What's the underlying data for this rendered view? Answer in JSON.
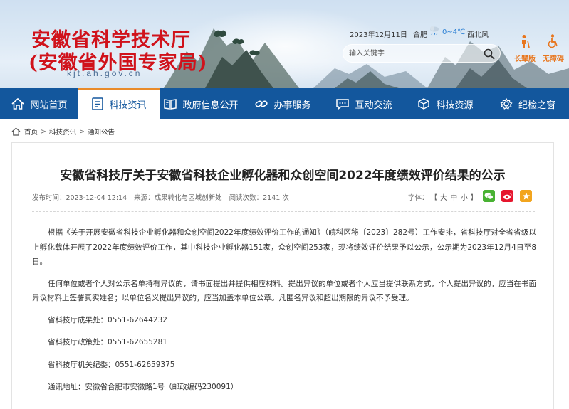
{
  "header": {
    "org_name_line1": "安徽省科学技术厅",
    "org_name_line2": "(安徽省外国专家局)",
    "url": "kjt.ah.gov.cn",
    "date": "2023年12月11日",
    "city": "合肥",
    "temperature": "0~4℃",
    "wind": "西北风",
    "search_placeholder": "输入关键字",
    "elder_mode_label": "长辈版",
    "accessibility_label": "无障碍"
  },
  "nav": {
    "items": [
      {
        "label": "网站首页",
        "icon": "home-icon"
      },
      {
        "label": "科技资讯",
        "icon": "document-icon",
        "active": true
      },
      {
        "label": "政府信息公开",
        "icon": "book-icon"
      },
      {
        "label": "办事服务",
        "icon": "link-icon"
      },
      {
        "label": "互动交流",
        "icon": "chat-icon"
      },
      {
        "label": "科技资源",
        "icon": "cube-icon"
      },
      {
        "label": "纪检之窗",
        "icon": "gear-icon"
      }
    ]
  },
  "breadcrumb": [
    "首页",
    "科技资讯",
    "通知公告"
  ],
  "article": {
    "title": "安徽省科技厅关于安徽省科技企业孵化器和众创空间2022年度绩效评价结果的公示",
    "publish_time": "发布时间：2023-12-04 12:14",
    "source": "来源：成果转化与区域创新处",
    "views": "阅读次数：2141 次",
    "font_label": "字体：",
    "font_large": "大",
    "font_medium": "中",
    "font_small": "小",
    "paragraphs": [
      "根据《关于开展安徽省科技企业孵化器和众创空间2022年度绩效评价工作的通知》（皖科区秘〔2023〕282号）工作安排，省科技厅对全省省级以上孵化载体开展了2022年度绩效评价工作，其中科技企业孵化器151家，众创空间253家，现将绩效评价结果予以公示，公示期为2023年12月4日至8日。",
      "任何单位或者个人对公示名单持有异议的，请书面提出并提供相应材料。提出异议的单位或者个人应当提供联系方式，个人提出异议的，应当在书面异议材料上签署真实姓名；以单位名义提出异议的，应当加盖本单位公章。凡匿名异议和超出期限的异议不予受理。"
    ],
    "contacts": [
      "省科技厅成果处：0551-62644232",
      "省科技厅政策处：0551-62655281",
      "省科技厅机关纪委：0551-62659375",
      "通讯地址：安徽省合肥市安徽路1号（邮政编码230091）"
    ]
  },
  "colors": {
    "nav_bg": "#13579d",
    "logo_red": "#d0121b",
    "accent_orange": "#e98b2a"
  }
}
